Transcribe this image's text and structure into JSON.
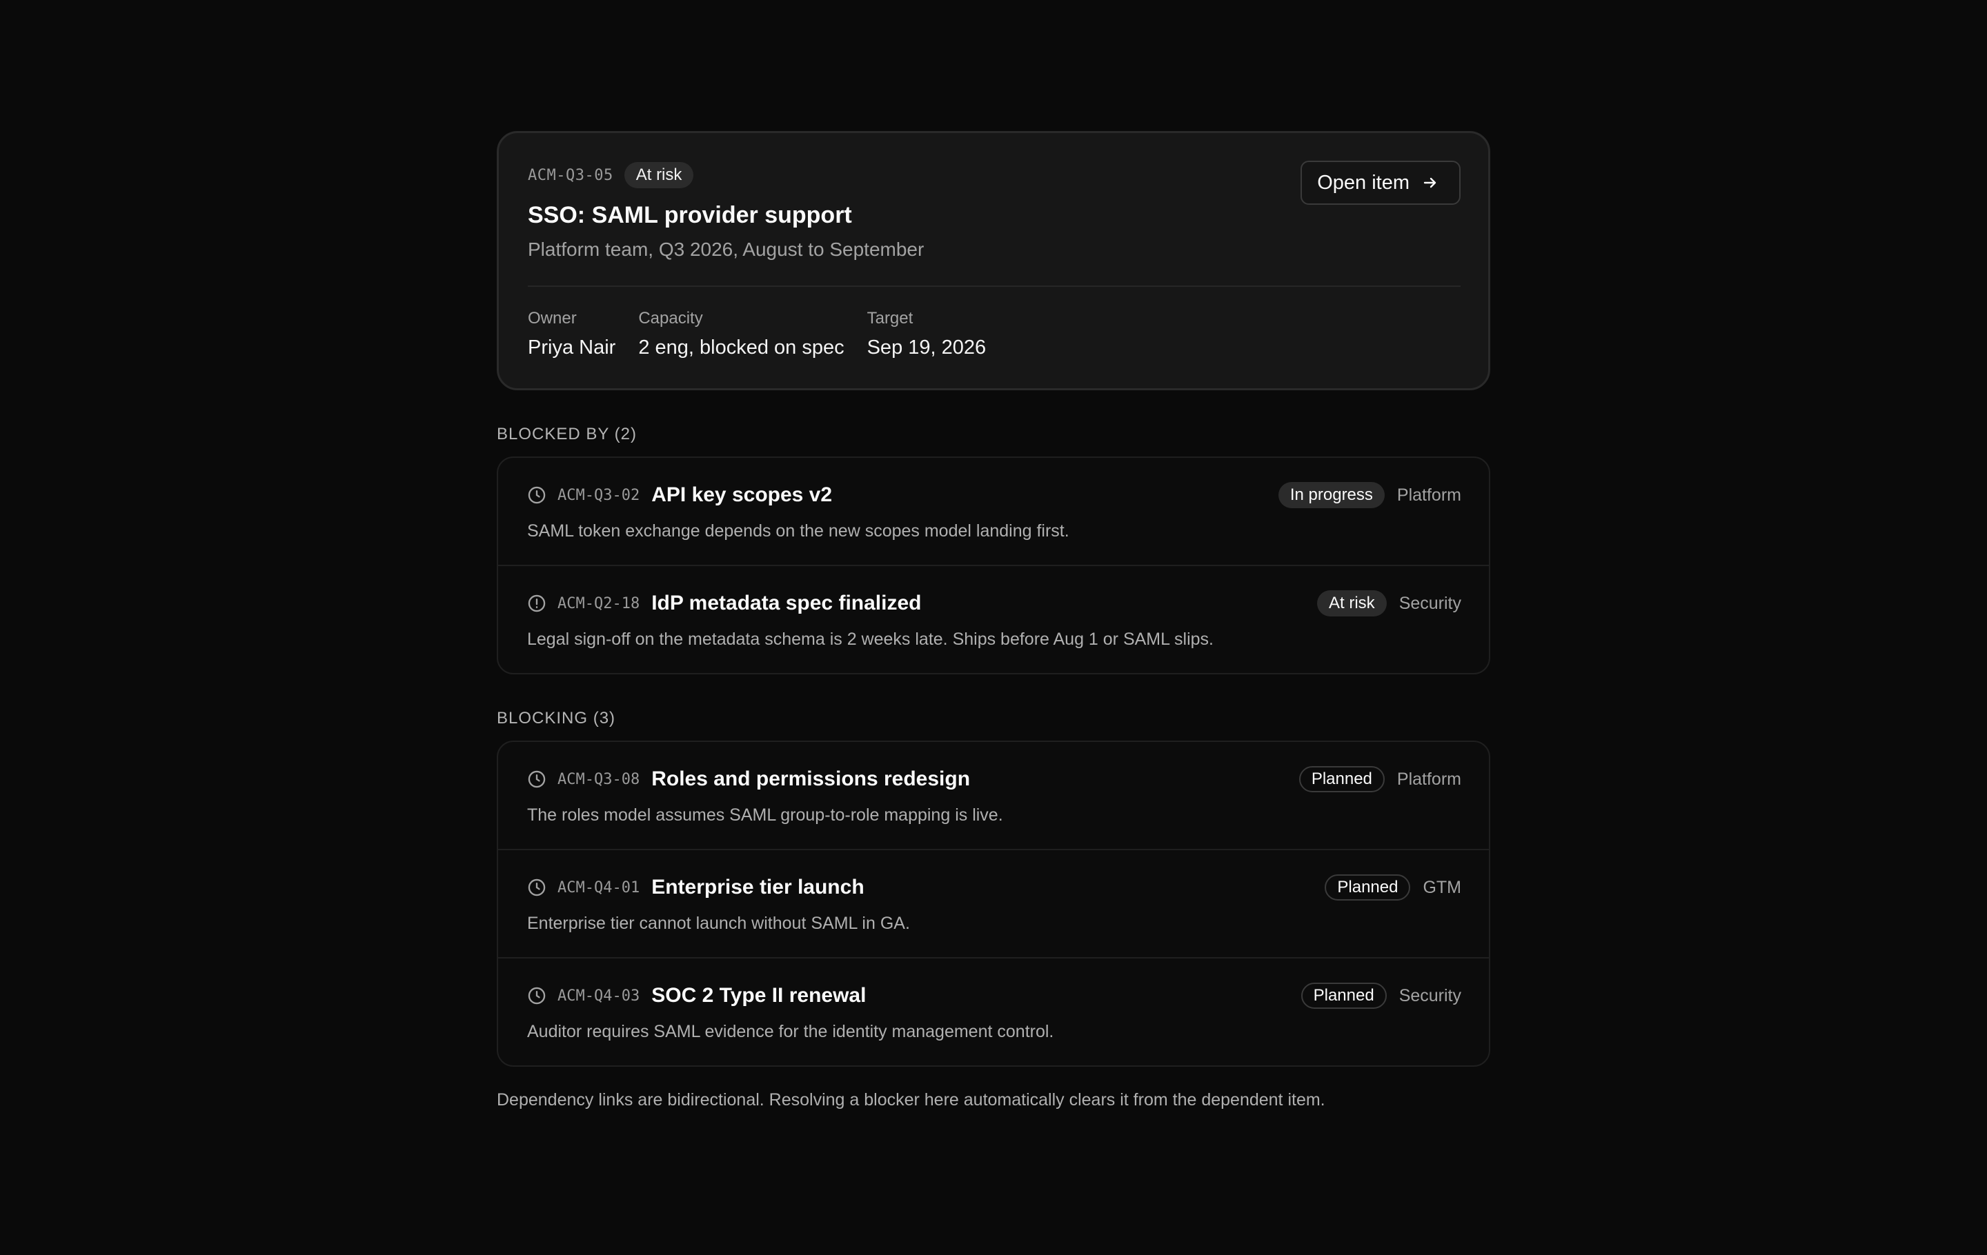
{
  "item": {
    "id": "ACM-Q3-05",
    "status": "At risk",
    "title": "SSO: SAML provider support",
    "subtitle": "Platform team, Q3 2026, August to September",
    "open_button": "Open item",
    "meta": [
      {
        "key": "Owner",
        "value": "Priya Nair"
      },
      {
        "key": "Capacity",
        "value": "2 eng, blocked on spec"
      },
      {
        "key": "Target",
        "value": "Sep 19, 2026"
      }
    ]
  },
  "blocked_by": {
    "label": "BLOCKED BY (2)",
    "rows": [
      {
        "icon": "clock-icon",
        "id": "ACM-Q3-02",
        "title": "API key scopes v2",
        "status": "In progress",
        "status_style": "filled",
        "team": "Platform",
        "desc": "SAML token exchange depends on the new scopes model landing first."
      },
      {
        "icon": "alert-circle-icon",
        "id": "ACM-Q2-18",
        "title": "IdP metadata spec finalized",
        "status": "At risk",
        "status_style": "filled",
        "team": "Security",
        "desc": "Legal sign-off on the metadata schema is 2 weeks late. Ships before Aug 1 or SAML slips."
      }
    ]
  },
  "blocking": {
    "label": "BLOCKING (3)",
    "rows": [
      {
        "icon": "clock-icon",
        "id": "ACM-Q3-08",
        "title": "Roles and permissions redesign",
        "status": "Planned",
        "status_style": "outline",
        "team": "Platform",
        "desc": "The roles model assumes SAML group-to-role mapping is live."
      },
      {
        "icon": "clock-icon",
        "id": "ACM-Q4-01",
        "title": "Enterprise tier launch",
        "status": "Planned",
        "status_style": "outline",
        "team": "GTM",
        "desc": "Enterprise tier cannot launch without SAML in GA."
      },
      {
        "icon": "clock-icon",
        "id": "ACM-Q4-03",
        "title": "SOC 2 Type II renewal",
        "status": "Planned",
        "status_style": "outline",
        "team": "Security",
        "desc": "Auditor requires SAML evidence for the identity management control."
      }
    ]
  },
  "footer": "Dependency links are bidirectional. Resolving a blocker here automatically clears it from the dependent item."
}
